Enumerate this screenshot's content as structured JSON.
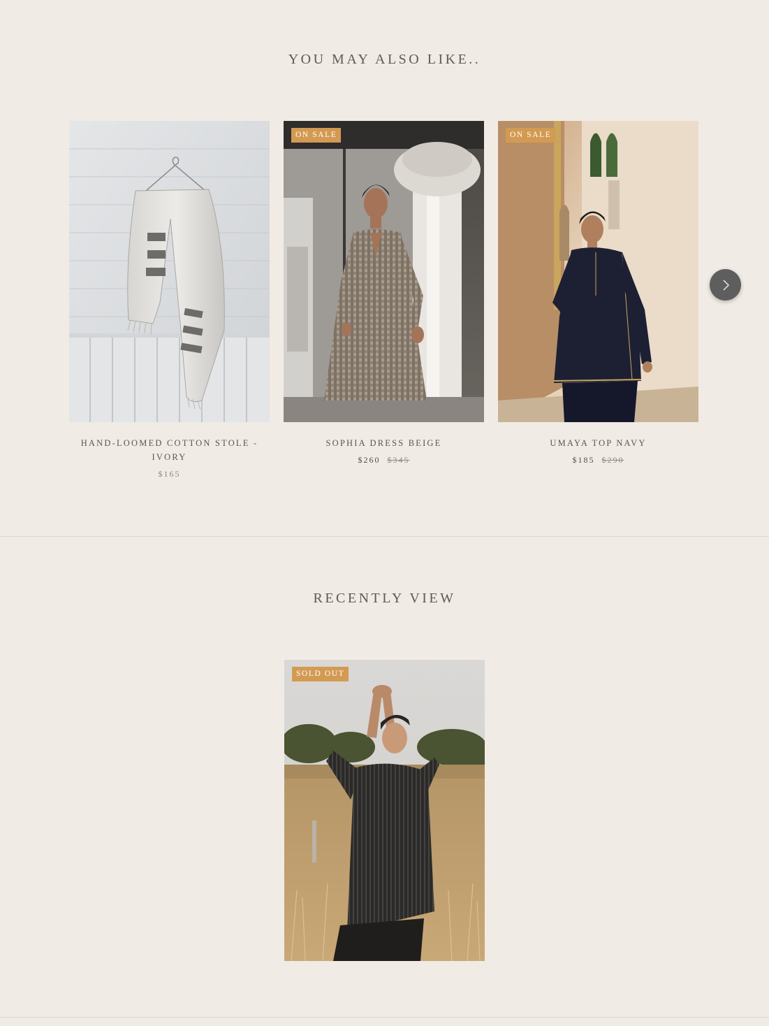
{
  "also_like": {
    "title": "YOU MAY ALSO LIKE..",
    "products": [
      {
        "name": "HAND-LOOMED COTTON STOLE - IVORY",
        "badge": "",
        "price": "$165",
        "was": ""
      },
      {
        "name": "SOPHIA DRESS BEIGE",
        "badge": "ON SALE",
        "price": "$260",
        "was": "$345"
      },
      {
        "name": "UMAYA TOP NAVY",
        "badge": "ON SALE",
        "price": "$185",
        "was": "$290"
      }
    ],
    "next_icon": "chevron-right-icon"
  },
  "recently_viewed": {
    "title": "RECENTLY VIEW",
    "products": [
      {
        "badge": "SOLD OUT"
      }
    ]
  },
  "colors": {
    "background": "#f1ebe5",
    "badge": "#d39a52",
    "text": "#5a5652",
    "carousel_button": "#5e5e5e"
  }
}
